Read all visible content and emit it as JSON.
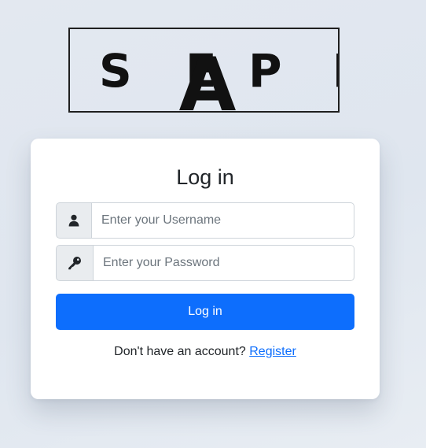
{
  "logo": {
    "text_left": "S E",
    "text_center": "A",
    "text_right": "P P"
  },
  "login": {
    "title": "Log in",
    "username": {
      "placeholder": "Enter your Username",
      "icon": "user-icon"
    },
    "password": {
      "placeholder": "Enter your Password",
      "icon": "key-icon"
    },
    "submit_label": "Log in",
    "footer_text": "Don't have an account?",
    "register_link": "Register"
  },
  "colors": {
    "primary": "#0d6efd",
    "addon_bg": "#e9ecef",
    "border": "#ced4da",
    "text": "#212529"
  }
}
